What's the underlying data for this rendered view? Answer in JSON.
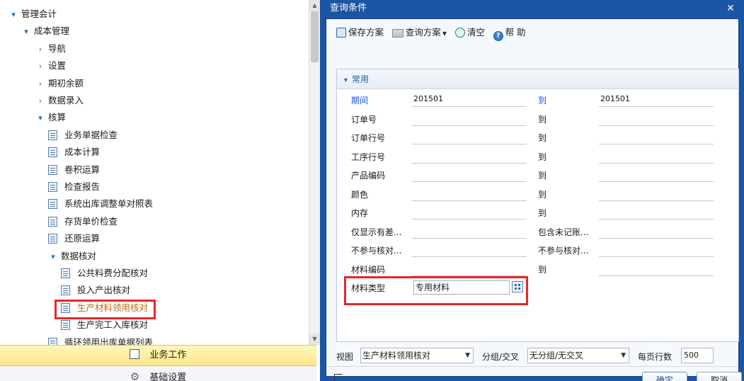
{
  "sidebar": {
    "tree": [
      {
        "label": "管理会计",
        "chevron": "▾",
        "kind": "folder",
        "active": false
      },
      {
        "label": "成本管理",
        "chevron": "▾",
        "kind": "folder",
        "active": false
      },
      {
        "label": "导航",
        "chevron": "›",
        "kind": "folder",
        "active": false
      },
      {
        "label": "设置",
        "chevron": "›",
        "kind": "folder",
        "active": false
      },
      {
        "label": "期初余额",
        "chevron": "›",
        "kind": "folder",
        "active": false
      },
      {
        "label": "数据录入",
        "chevron": "›",
        "kind": "folder",
        "active": false
      },
      {
        "label": "核算",
        "chevron": "▾",
        "kind": "folder",
        "active": false
      },
      {
        "label": "业务单据检查",
        "kind": "doc",
        "active": false
      },
      {
        "label": "成本计算",
        "kind": "doc",
        "active": false
      },
      {
        "label": "卷积运算",
        "kind": "doc",
        "active": false
      },
      {
        "label": "检查报告",
        "kind": "doc",
        "active": false
      },
      {
        "label": "系统出库调整单对照表",
        "kind": "doc",
        "active": false
      },
      {
        "label": "存货单价检查",
        "kind": "doc",
        "active": false
      },
      {
        "label": "还原运算",
        "kind": "doc",
        "active": false
      },
      {
        "label": "数据核对",
        "chevron": "▾",
        "kind": "folder",
        "active": false
      },
      {
        "label": "公共料费分配核对",
        "kind": "doc",
        "active": false
      },
      {
        "label": "投入产出核对",
        "kind": "doc",
        "active": false
      },
      {
        "label": "生产材料领用核对",
        "kind": "doc",
        "active": true
      },
      {
        "label": "生产完工入库核对",
        "kind": "doc",
        "active": false
      },
      {
        "label": "循环领用出库单据列表",
        "kind": "doc",
        "active": false
      }
    ],
    "nav_work": "业务工作",
    "nav_base": "基础设置"
  },
  "dialog": {
    "title": "查询条件",
    "close_glyph": "✕",
    "toolbar": {
      "save_scheme": "保存方案",
      "query_scheme": "查询方案",
      "clear": "清空",
      "help": "帮 助"
    },
    "section_title": "常用",
    "section_chevron": "▾",
    "to_label": "到",
    "fields": [
      {
        "label": "期间",
        "highlight": true,
        "from": "201501",
        "to": "201501"
      },
      {
        "label": "订单号",
        "from": "",
        "to": ""
      },
      {
        "label": "订单行号",
        "from": "",
        "to": ""
      },
      {
        "label": "工序行号",
        "from": "",
        "to": ""
      },
      {
        "label": "产品编码",
        "from": "",
        "to": ""
      },
      {
        "label": "颜色",
        "from": "",
        "to": ""
      },
      {
        "label": "内存",
        "from": "",
        "to": ""
      },
      {
        "label": "仅显示有差...",
        "right_label": "包含未记账..."
      },
      {
        "label": "不参与核对...",
        "right_label": "不参与核对..."
      },
      {
        "label": "材料编码",
        "from": "",
        "to": ""
      }
    ],
    "material_type": {
      "label": "材料类型",
      "value": "专用材料"
    },
    "bottom": {
      "view_label": "视图",
      "view_value": "生产材料领用核对",
      "group_label": "分组/交叉",
      "group_value": "无分组/无交叉",
      "rows_label": "每页行数",
      "rows_value": "500"
    },
    "ok": "确定",
    "cancel": "取消"
  },
  "colors": {
    "dialog_frame": "#1b55a3",
    "highlight_box": "#e8262a",
    "nav_active": "#fbe68a"
  }
}
